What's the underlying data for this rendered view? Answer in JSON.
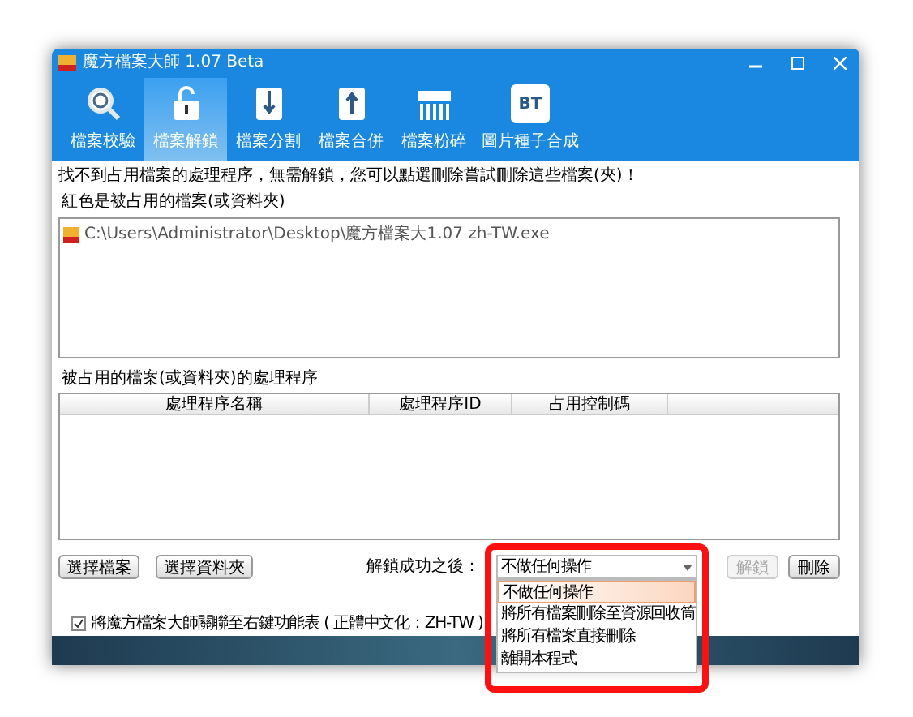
{
  "window": {
    "title": "魔方檔案大師 1.07 Beta"
  },
  "tabs": [
    {
      "label": "檔案校驗",
      "selected": false,
      "kind": "magnifier"
    },
    {
      "label": "檔案解鎖",
      "selected": true,
      "kind": "lock"
    },
    {
      "label": "檔案分割",
      "selected": false,
      "kind": "split"
    },
    {
      "label": "檔案合併",
      "selected": false,
      "kind": "merge"
    },
    {
      "label": "檔案粉碎",
      "selected": false,
      "kind": "shredder"
    },
    {
      "label": "圖片種子合成",
      "selected": false,
      "kind": "bt",
      "icon_text": "BT"
    }
  ],
  "message": "找不到占用檔案的處理程序，無需解鎖，您可以點選刪除嘗試刪除這些檔案(夾)！",
  "locked_files": {
    "label": "紅色是被占用的檔案(或資料夾)",
    "items": [
      "C:\\Users\\Administrator\\Desktop\\魔方檔案大1.07 zh-TW.exe"
    ]
  },
  "process_table": {
    "label": "被占用的檔案(或資料夾)的處理程序",
    "columns": [
      "處理程序名稱",
      "處理程序ID",
      "占用控制碼"
    ]
  },
  "buttons": [
    {
      "label": "選擇檔案",
      "disabled": false
    },
    {
      "label": "選擇資料夾",
      "disabled": false
    }
  ],
  "after_unlock": {
    "label": "解鎖成功之後：",
    "value": "不做任何操作",
    "options": [
      {
        "label": "不做任何操作",
        "selected": true
      },
      {
        "label": "將所有檔案刪除至資源回收筒",
        "selected": false
      },
      {
        "label": "將所有檔案直接刪除",
        "selected": false
      },
      {
        "label": "離開本程式",
        "selected": false
      }
    ]
  },
  "action_buttons": [
    {
      "label": "解鎖",
      "disabled": true
    },
    {
      "label": "刪除",
      "disabled": false
    }
  ],
  "context_menu_option": {
    "label": "將魔方檔案大師關聯至右鍵功能表 ( 正體中文化：ZH-TW )",
    "checked": true
  }
}
